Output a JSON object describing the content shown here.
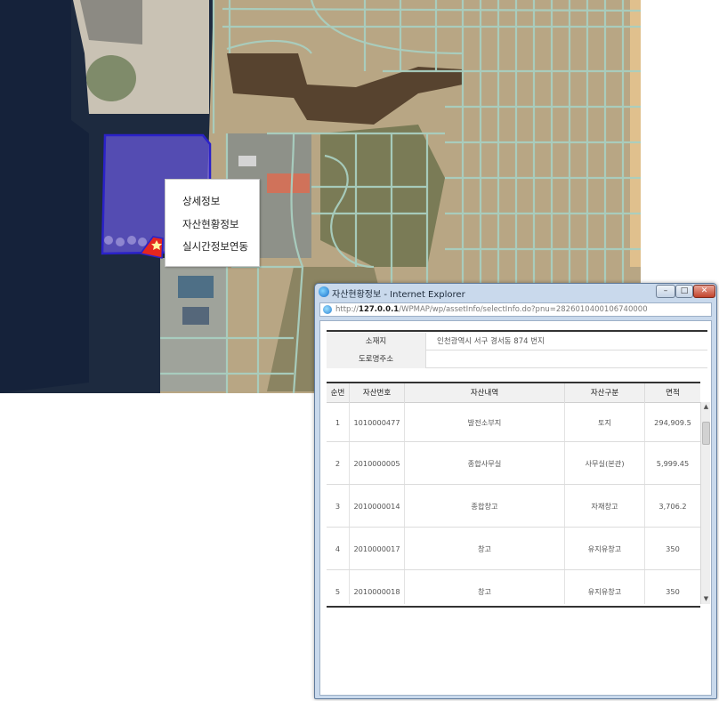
{
  "context_menu": {
    "items": [
      {
        "label": "상세정보"
      },
      {
        "label": "자산현황정보"
      },
      {
        "label": "실시간정보연동"
      }
    ]
  },
  "popup": {
    "title": "자산현황정보 - Internet Explorer",
    "url": {
      "prefix": "http://",
      "host": "127.0.0.1",
      "path": "/WPMAP/wp/assetInfo/selectInfo.do?pnu=2826010400106740000"
    },
    "info": [
      {
        "key": "소재지",
        "value": "인천광역시 서구 경서동 874 번지"
      },
      {
        "key": "도로명주소",
        "value": ""
      }
    ],
    "table": {
      "headers": [
        "순번",
        "자산번호",
        "자산내역",
        "자산구분",
        "면적"
      ],
      "rows": [
        {
          "no": "1",
          "asset_no": "1010000477",
          "detail": "발전소부지",
          "category": "토지",
          "area": "294,909.5"
        },
        {
          "no": "2",
          "asset_no": "2010000005",
          "detail": "종합사무실",
          "category": "사무실(본관)",
          "area": "5,999.45"
        },
        {
          "no": "3",
          "asset_no": "2010000014",
          "detail": "종합창고",
          "category": "자재창고",
          "area": "3,706.2"
        },
        {
          "no": "4",
          "asset_no": "2010000017",
          "detail": "창고",
          "category": "유지유창고",
          "area": "350"
        },
        {
          "no": "5",
          "asset_no": "2010000018",
          "detail": "창고",
          "category": "유지유창고",
          "area": "350"
        }
      ]
    }
  },
  "colors": {
    "selection_fill": "#6a5adf",
    "selection_stroke": "#2b22c9",
    "marker": "#e5261f",
    "road": "#a9cfc0"
  }
}
